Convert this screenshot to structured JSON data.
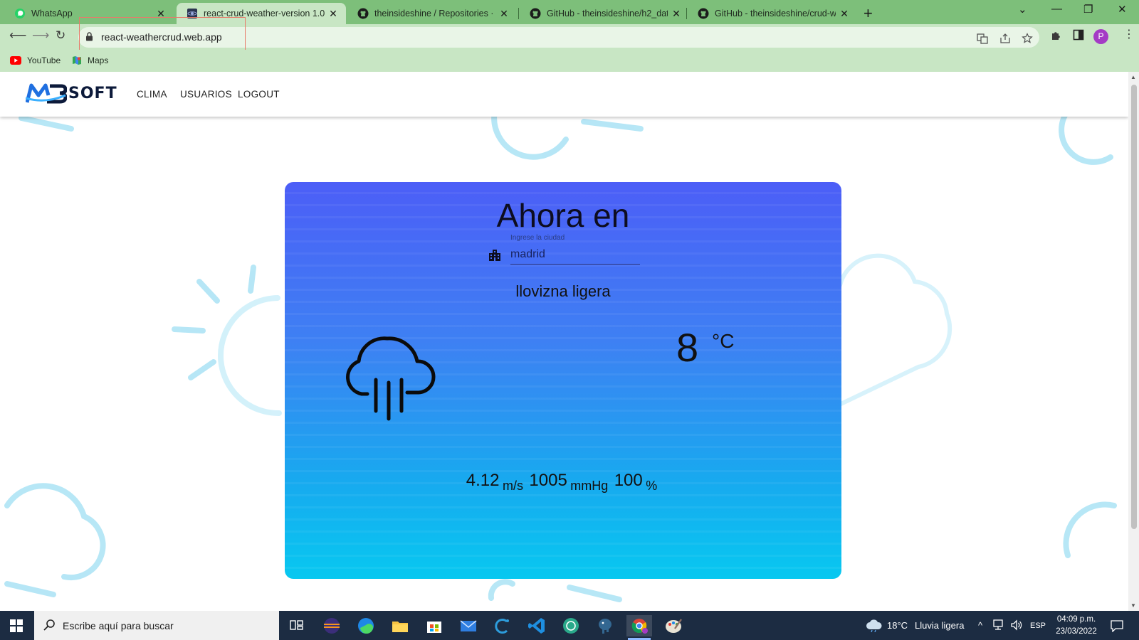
{
  "browser": {
    "tabs": [
      {
        "title": "WhatsApp",
        "icon": "whatsapp-icon"
      },
      {
        "title": "react-crud-weather-version 1.0.0",
        "icon": "react-app-icon"
      },
      {
        "title": "theinsideshine / Repositories · Gi",
        "icon": "github-icon"
      },
      {
        "title": "GitHub - theinsideshine/h2_data",
        "icon": "github-icon"
      },
      {
        "title": "GitHub - theinsideshine/crud-we",
        "icon": "github-icon"
      }
    ],
    "url": "react-weathercrud.web.app",
    "profile_initial": "P",
    "bookmarks": [
      {
        "label": "YouTube",
        "icon": "youtube-icon"
      },
      {
        "label": "Maps",
        "icon": "maps-icon"
      }
    ]
  },
  "app": {
    "logo_text": "SOFT",
    "nav": [
      "CLIMA",
      "USUARIOS",
      "LOGOUT"
    ]
  },
  "weather": {
    "title": "Ahora en",
    "city_label": "Ingrese la ciudad",
    "city": "madrid",
    "description": "llovizna ligera",
    "temperature": "8",
    "temperature_unit": "°C",
    "wind": "4.12",
    "wind_unit": "m/s",
    "pressure": "1005",
    "pressure_unit": "mmHg",
    "humidity": "100",
    "humidity_unit": "%",
    "icon": "rain-cloud-icon"
  },
  "taskbar": {
    "search_placeholder": "Escribe aquí para buscar",
    "weather_temp": "18°C",
    "weather_text": "Lluvia ligera",
    "language": "ESP",
    "time": "04:09 p.m.",
    "date": "23/03/2022"
  }
}
